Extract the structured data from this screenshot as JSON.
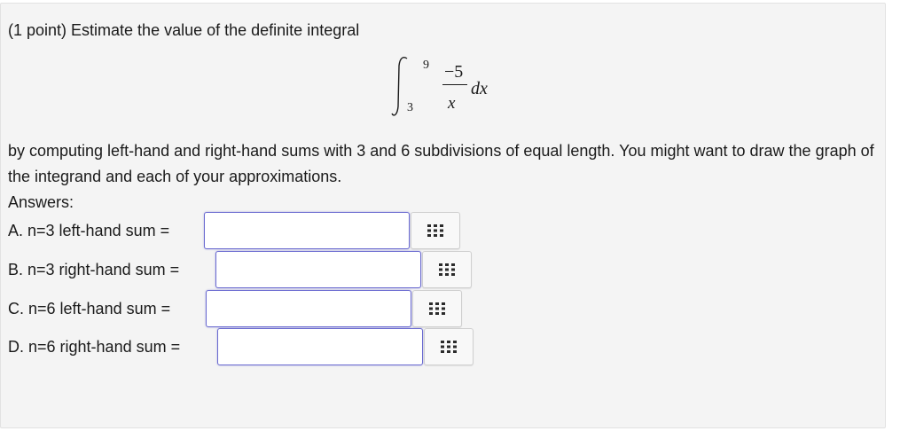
{
  "problem": {
    "header": "(1 point) Estimate the value of the definite integral",
    "integral": {
      "lower": "3",
      "upper": "9",
      "numerator": "−5",
      "denominator": "x",
      "differential": "dx"
    },
    "body": "by computing left-hand and right-hand sums with 3 and 6 subdivisions of equal length. You might want to draw the graph of the integrand and each of your approximations.",
    "answers_label": "Answers:"
  },
  "answers": [
    {
      "label": "A. n=3 left-hand sum =",
      "value": "",
      "icon": "equation-palette-icon"
    },
    {
      "label": "B. n=3 right-hand sum =",
      "value": "",
      "icon": "equation-palette-icon"
    },
    {
      "label": "C. n=6 left-hand sum =",
      "value": "",
      "icon": "equation-palette-icon"
    },
    {
      "label": "D. n=6 right-hand sum =",
      "value": "",
      "icon": "equation-palette-icon"
    }
  ],
  "colors": {
    "panel_background": "#f4f4f4",
    "input_border": "#6a6ad0",
    "icon_color": "#2b2b2b"
  }
}
